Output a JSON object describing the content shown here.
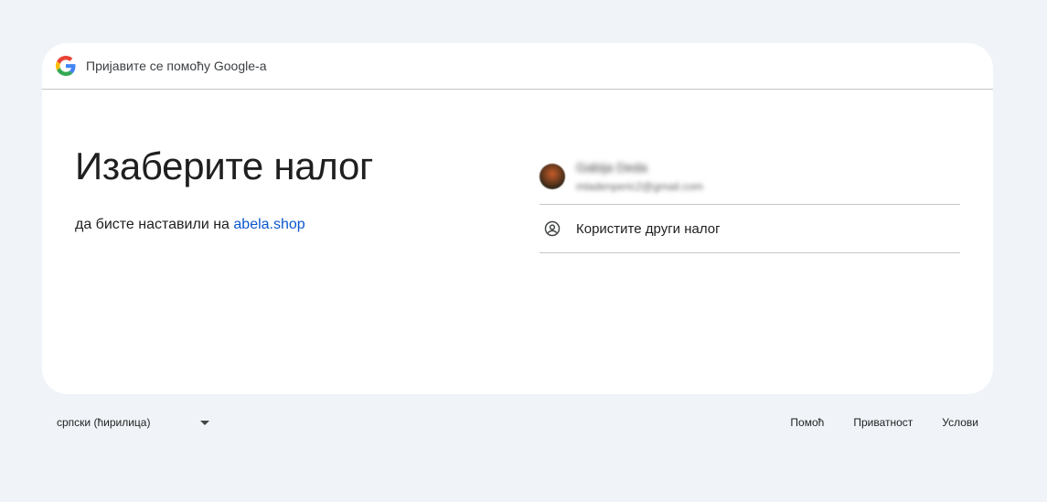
{
  "header": {
    "text": "Пријавите се помоћу Google-а",
    "logo_icon": "google-g-icon"
  },
  "main": {
    "title": "Изаберите налог",
    "subtitle_prefix": "да бисте наставили на ",
    "site_link": "abela.shop"
  },
  "accounts": [
    {
      "name": "Gabija Deda",
      "email": "mladenperic2@gmail.com",
      "avatar_icon": "avatar"
    }
  ],
  "other_account": {
    "label": "Користите други налог",
    "icon": "account-circle-icon"
  },
  "footer": {
    "language": "српски (ћирилица)",
    "links": [
      "Помоћ",
      "Приватност",
      "Услови"
    ]
  },
  "colors": {
    "background": "#f0f4f9",
    "card": "#ffffff",
    "link": "#0b57d0",
    "divider": "#c4c7c5"
  }
}
